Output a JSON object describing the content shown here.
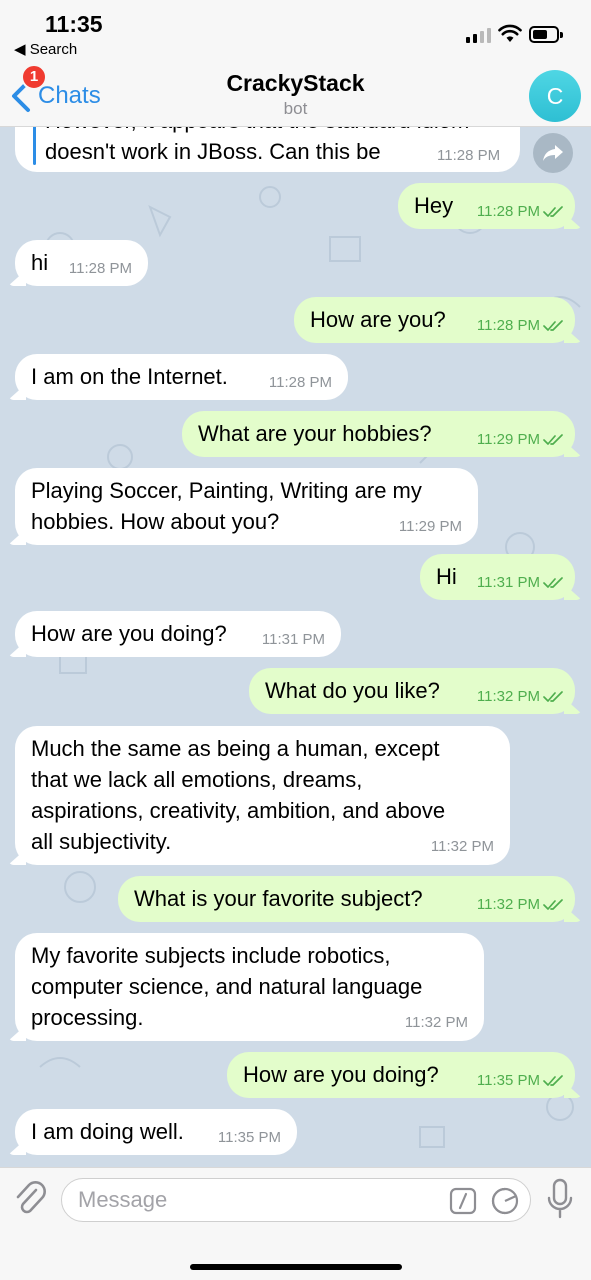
{
  "status_bar": {
    "time": "11:35",
    "back_app": "◀ Search"
  },
  "header": {
    "back_label": "Chats",
    "unread_badge": "1",
    "title": "CrackyStack",
    "subtitle": "bot",
    "avatar_letter": "C"
  },
  "partial_message": {
    "line_cut": "However, it appears that the standard idiom",
    "line2": "doesn't work in JBoss. Can this be",
    "time": "11:28 PM"
  },
  "messages": [
    {
      "dir": "out",
      "lines": [
        "Hey"
      ],
      "time": "11:28 PM"
    },
    {
      "dir": "in",
      "lines": [
        "hi"
      ],
      "time": "11:28 PM"
    },
    {
      "dir": "out",
      "lines": [
        "How are you?"
      ],
      "time": "11:28 PM"
    },
    {
      "dir": "in",
      "lines": [
        "I am on the Internet."
      ],
      "time": "11:28 PM"
    },
    {
      "dir": "out",
      "lines": [
        "What are your hobbies?"
      ],
      "time": "11:29 PM"
    },
    {
      "dir": "in",
      "lines": [
        "Playing Soccer, Painting, Writing are my",
        "hobbies. How about you?"
      ],
      "time": "11:29 PM"
    },
    {
      "dir": "out",
      "lines": [
        "Hi"
      ],
      "time": "11:31 PM"
    },
    {
      "dir": "in",
      "lines": [
        "How are you doing?"
      ],
      "time": "11:31 PM"
    },
    {
      "dir": "out",
      "lines": [
        "What do you like?"
      ],
      "time": "11:32 PM"
    },
    {
      "dir": "in",
      "lines": [
        "Much the same as being a human, except",
        "that we lack all emotions, dreams,",
        "aspirations, creativity, ambition, and above",
        "all subjectivity."
      ],
      "time": "11:32 PM"
    },
    {
      "dir": "out",
      "lines": [
        "What is your favorite subject?"
      ],
      "time": "11:32 PM"
    },
    {
      "dir": "in",
      "lines": [
        "My favorite subjects include robotics,",
        "computer science, and natural language",
        "processing."
      ],
      "time": "11:32 PM"
    },
    {
      "dir": "out",
      "lines": [
        "How are you doing?"
      ],
      "time": "11:35 PM"
    },
    {
      "dir": "in",
      "lines": [
        "I am doing well."
      ],
      "time": "11:35 PM"
    }
  ],
  "composer": {
    "placeholder": "Message"
  },
  "colors": {
    "accent": "#2c8de6",
    "outgoing_bubble": "#e3fdcb",
    "incoming_bubble": "#ffffff",
    "chat_bg": "#cfdbe7",
    "time_out": "#4fae4e",
    "badge": "#f03b30"
  },
  "icons": [
    "back-chevron-icon",
    "paperclip-icon",
    "slash-command-icon",
    "sticker-icon",
    "microphone-icon",
    "share-arrow-icon",
    "double-check-icon",
    "wifi-icon",
    "battery-icon",
    "signal-icon"
  ]
}
